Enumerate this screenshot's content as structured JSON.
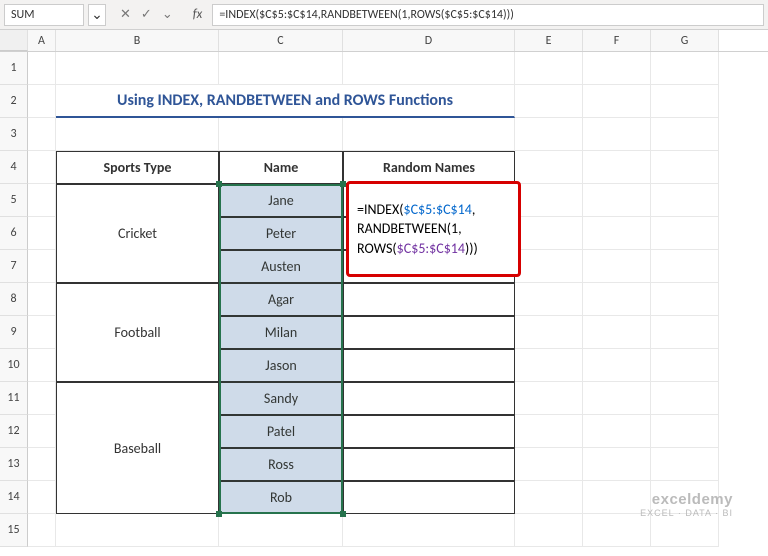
{
  "namebox": "SUM",
  "formula_bar": "=INDEX($C$5:$C$14,RANDBETWEEN(1,ROWS($C$5:$C$14)))",
  "icons": {
    "cancel": "✕",
    "enter": "✓",
    "chevron": "⌄"
  },
  "fx": "fx",
  "columns": [
    "A",
    "B",
    "C",
    "D",
    "E",
    "F",
    "G"
  ],
  "rows": [
    "1",
    "2",
    "3",
    "4",
    "5",
    "6",
    "7",
    "8",
    "9",
    "10",
    "11",
    "12",
    "13",
    "14",
    "15"
  ],
  "title": "Using INDEX, RANDBETWEEN and ROWS Functions",
  "table": {
    "headers": {
      "sports": "Sports Type",
      "name": "Name",
      "random": "Random Names"
    },
    "groups": [
      {
        "sport": "Cricket",
        "names": [
          "Jane",
          "Peter",
          "Austen"
        ]
      },
      {
        "sport": "Football",
        "names": [
          "Agar",
          "Milan",
          "Jason"
        ]
      },
      {
        "sport": "Baseball",
        "names": [
          "Sandy",
          "Patel",
          "Ross",
          "Rob"
        ]
      }
    ]
  },
  "formula_display": {
    "line1": {
      "pre": "=INDEX(",
      "ref": "$C$5:$C$14",
      "post": ","
    },
    "line2": {
      "pre": "RANDBETWEEN(",
      "num": "1",
      "post": ","
    },
    "line3": {
      "pre": "ROWS(",
      "ref": "$C$5:$C$14",
      "post": ")))"
    }
  },
  "watermark": {
    "line1": "exceldemy",
    "line2": "EXCEL · DATA · BI"
  }
}
